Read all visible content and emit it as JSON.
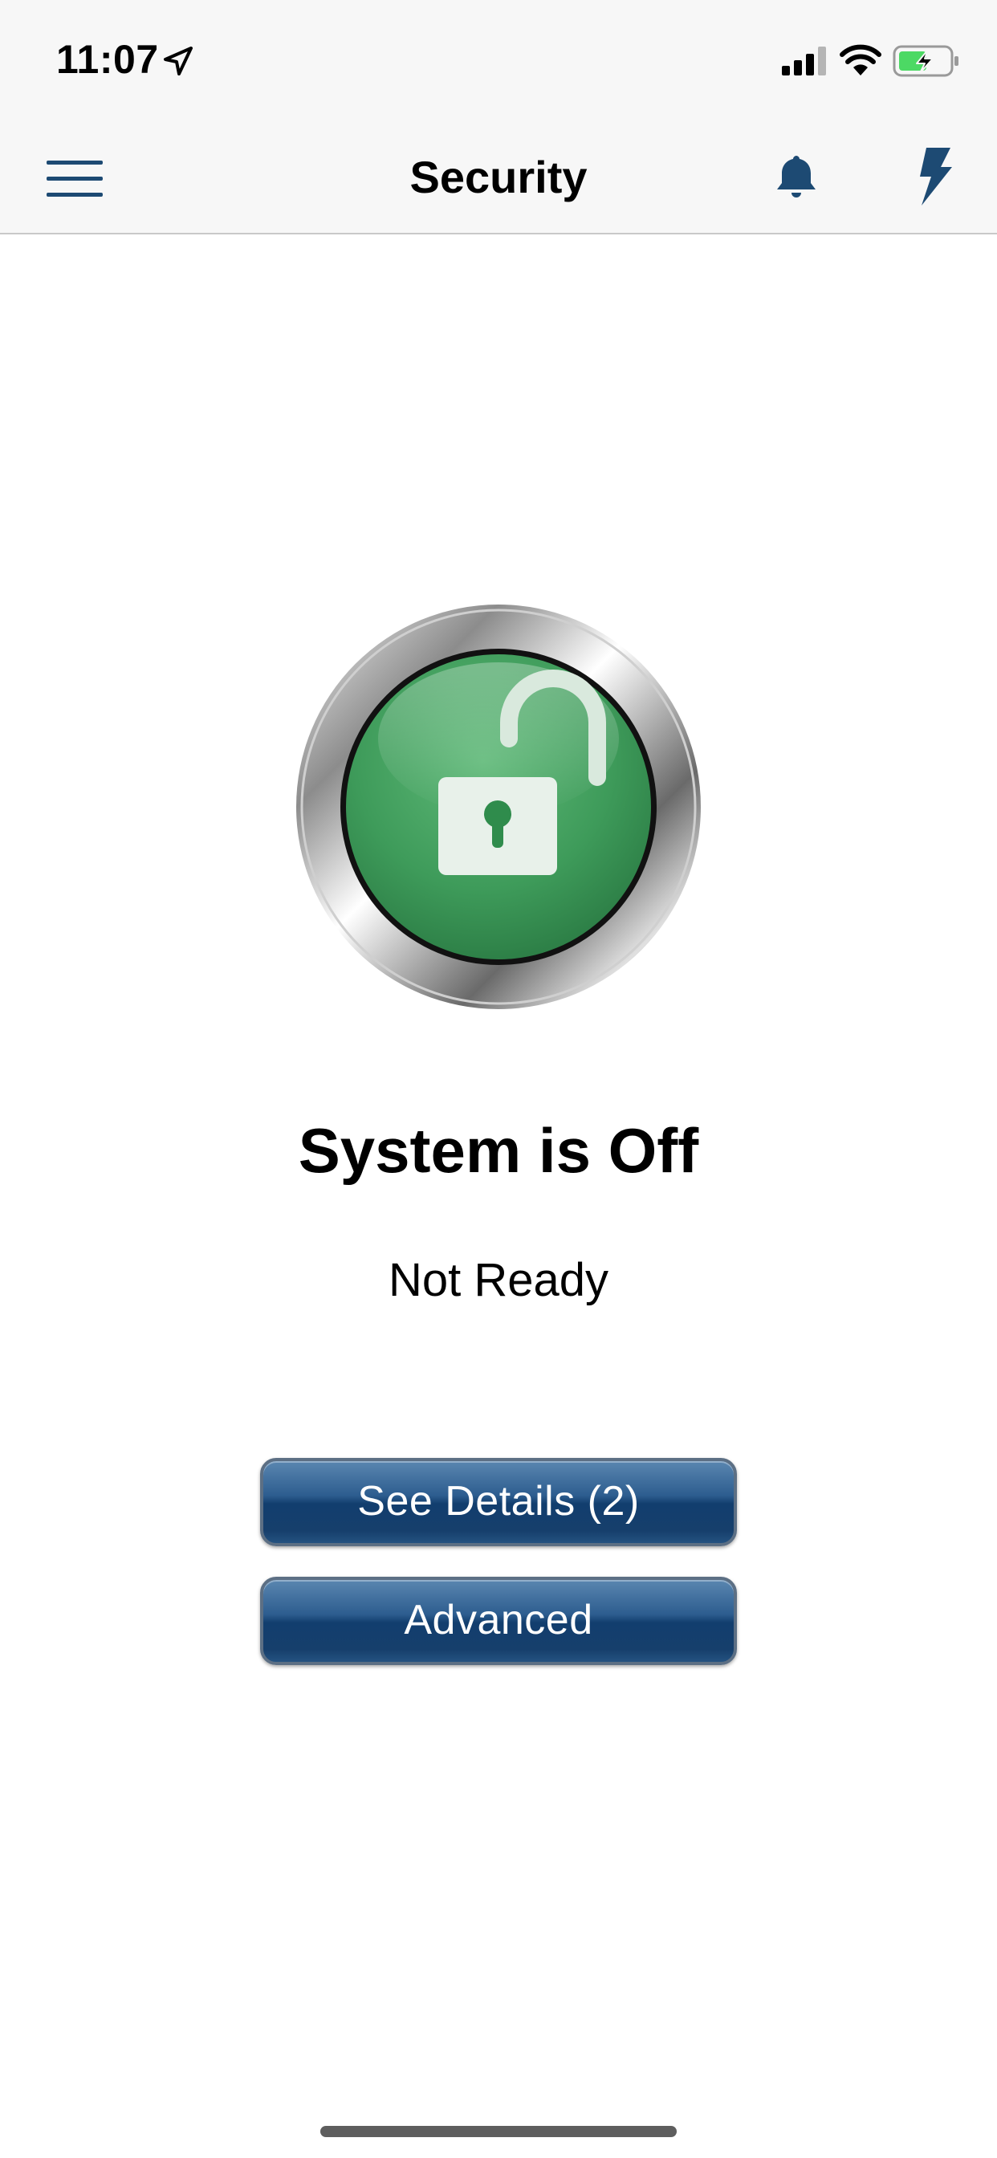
{
  "status_bar": {
    "time": "11:07",
    "icons": [
      "location-arrow-icon",
      "signal-icon",
      "wifi-icon",
      "battery-charging-icon"
    ]
  },
  "nav_bar": {
    "title": "Security",
    "left_icon": "menu-icon",
    "right_icons": [
      "bell-icon",
      "bolt-icon"
    ],
    "icon_color": "#1d4a73"
  },
  "main": {
    "lock_icon": "unlocked-padlock-icon",
    "lock_color": "#3e9b5a",
    "status_heading": "System is Off",
    "status_subtext": "Not Ready",
    "buttons": [
      {
        "label": "See Details (2)"
      },
      {
        "label": "Advanced"
      }
    ],
    "button_color": "#163f6c"
  }
}
